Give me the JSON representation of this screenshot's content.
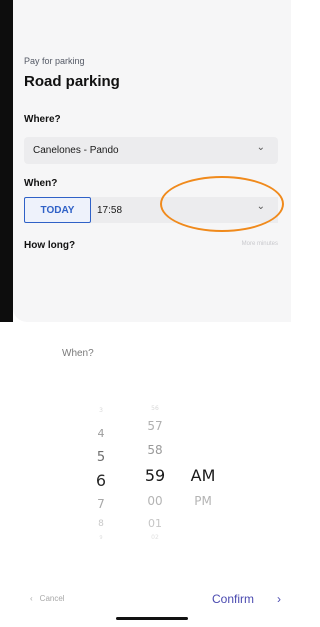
{
  "form": {
    "subtitle": "Pay for parking",
    "title": "Road parking",
    "where_label": "Where?",
    "where_value": "Canelones - Pando",
    "when_label": "When?",
    "today_label": "TODAY",
    "time_value": "17:58",
    "how_long_label": "How long?",
    "more_minutes_label": "More minutes"
  },
  "picker": {
    "title": "When?",
    "hours": [
      "3",
      "4",
      "5",
      "6",
      "7",
      "8",
      "9"
    ],
    "selected_hour": "6",
    "minutes": [
      "56",
      "57",
      "58",
      "59",
      "00",
      "01",
      "02"
    ],
    "selected_minute": "59",
    "ampm": [
      "AM",
      "PM"
    ],
    "selected_ampm": "AM"
  },
  "footer": {
    "cancel_label": "Cancel",
    "confirm_label": "Confirm"
  },
  "colors": {
    "accent_blue": "#2f61c7",
    "annotation_orange": "#f08a1c",
    "confirm_purple": "#4a4ab0"
  },
  "icons": {
    "where_dropdown": "chevron-down-icon",
    "time_dropdown": "chevron-down-icon",
    "cancel_back": "chevron-left-icon",
    "confirm_forward": "chevron-right-icon"
  }
}
